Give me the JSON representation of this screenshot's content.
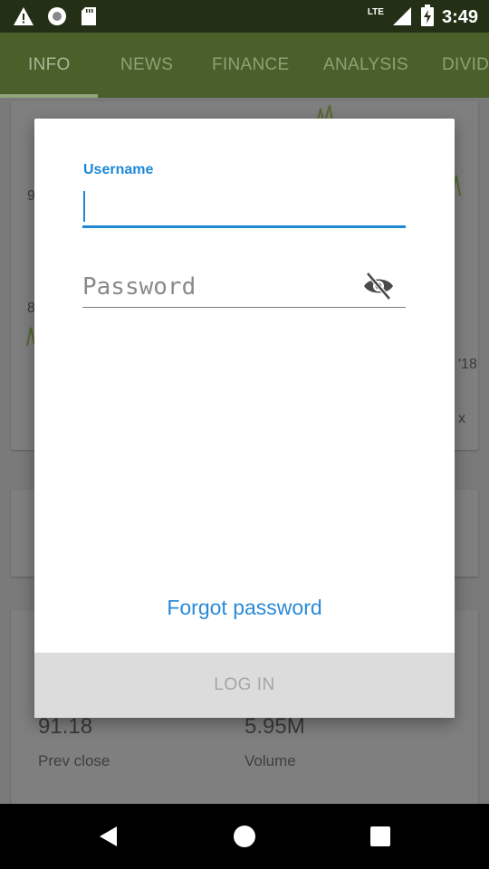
{
  "status_bar": {
    "icons": [
      "warning-icon",
      "sync-circle-icon",
      "sd-card-icon"
    ],
    "network": "LTE",
    "time": "3:49"
  },
  "tabs": [
    {
      "label": "INFO",
      "active": true
    },
    {
      "label": "NEWS",
      "active": false
    },
    {
      "label": "FINANCE",
      "active": false
    },
    {
      "label": "ANALYSIS",
      "active": false
    },
    {
      "label": "DIVID",
      "active": false
    }
  ],
  "background": {
    "stats": [
      {
        "value": "91.18",
        "label": "Prev close"
      },
      {
        "value": "5.95M",
        "label": "Volume"
      }
    ]
  },
  "dialog": {
    "username_label": "Username",
    "username_value": "",
    "password_placeholder": "Password",
    "forgot_password": "Forgot password",
    "login_button": "LOG IN"
  },
  "colors": {
    "accent": "#1e88d4",
    "toolbar": "#4b5f2a",
    "statusbar": "#243016"
  }
}
